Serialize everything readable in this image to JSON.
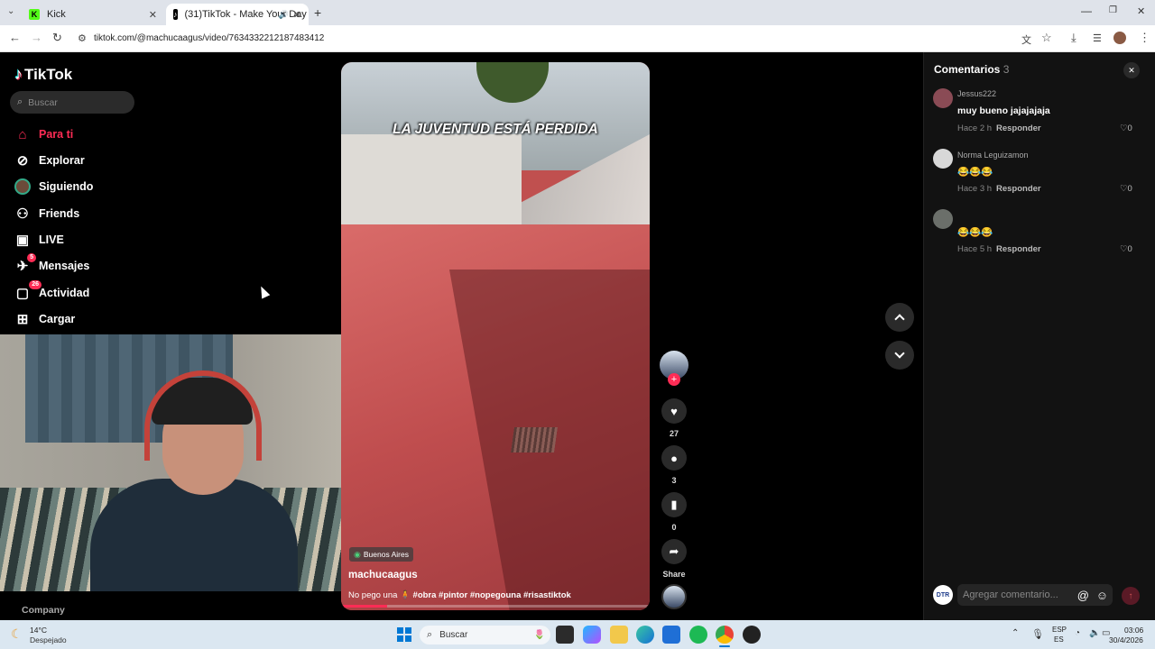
{
  "browser": {
    "tabs": [
      {
        "title": "Kick",
        "favicon": "K"
      },
      {
        "title": "(31)TikTok - Make Your Day",
        "favicon": "♪"
      }
    ],
    "url": "tiktok.com/@machucaagus/video/7634332212187483412"
  },
  "sidebar": {
    "logo_text": "TikTok",
    "search_placeholder": "Buscar",
    "items": [
      {
        "label": "Para ti",
        "icon": "home-icon",
        "active": true
      },
      {
        "label": "Explorar",
        "icon": "compass-icon"
      },
      {
        "label": "Siguiendo",
        "icon": "following-avatar-icon"
      },
      {
        "label": "Friends",
        "icon": "friends-icon"
      },
      {
        "label": "LIVE",
        "icon": "live-icon"
      },
      {
        "label": "Mensajes",
        "icon": "messages-icon",
        "badge": "5"
      },
      {
        "label": "Actividad",
        "icon": "activity-icon",
        "badge": "26"
      },
      {
        "label": "Cargar",
        "icon": "upload-icon"
      }
    ],
    "footer": "Company"
  },
  "video": {
    "overlay_text": "LA JUVENTUD ESTÁ PERDIDA",
    "location": "Buenos Aires",
    "author": "machucaagus",
    "caption_prefix": "No pego una",
    "hashtags": "#obra #pintor #nopegouna #risastiktok"
  },
  "actions": {
    "likes": "27",
    "comments": "3",
    "saves": "0",
    "share_label": "Share"
  },
  "comments_panel": {
    "title": "Comentarios",
    "count": "3",
    "items": [
      {
        "user": "Jessus222",
        "text": "muy bueno jajajajaja",
        "time": "Hace 2 h",
        "reply": "Responder",
        "likes": "0"
      },
      {
        "user": "Norma Leguizamon",
        "text": "😂😂😂",
        "time": "Hace 3 h",
        "reply": "Responder",
        "likes": "0"
      },
      {
        "user": "",
        "text": "😂😂😂",
        "time": "Hace 5 h",
        "reply": "Responder",
        "likes": "0"
      }
    ],
    "input_placeholder": "Agregar comentario..."
  },
  "taskbar": {
    "weather_temp": "14°C",
    "weather_desc": "Despejado",
    "search_placeholder": "Buscar",
    "lang_top": "ESP",
    "lang_bottom": "ES",
    "time": "03:06",
    "date": "30/4/2026"
  },
  "colors": {
    "accent": "#fe2c55",
    "panel": "#121212",
    "taskbar": "#dbe7f1"
  }
}
